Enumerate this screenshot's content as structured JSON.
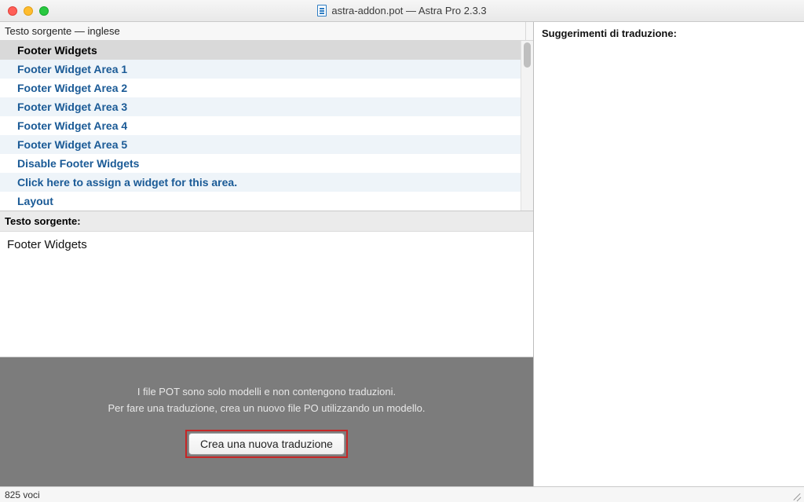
{
  "window": {
    "title": "astra-addon.pot — Astra Pro 2.3.3"
  },
  "left_panel": {
    "list_header": "Testo sorgente — inglese",
    "rows": [
      "Footer Widgets",
      "Footer Widget Area 1",
      "Footer Widget Area 2",
      "Footer Widget Area 3",
      "Footer Widget Area 4",
      "Footer Widget Area 5",
      "Disable Footer Widgets",
      "Click here to assign a widget for this area.",
      "Layout"
    ],
    "selected_index": 0
  },
  "source_section": {
    "label": "Testo sorgente:",
    "text": "Footer Widgets"
  },
  "pot_banner": {
    "line1": "I file POT sono solo modelli e non contengono traduzioni.",
    "line2": "Per fare una traduzione, crea un nuovo file PO utilizzando un modello.",
    "button": "Crea una nuova traduzione"
  },
  "right_panel": {
    "heading": "Suggerimenti di traduzione:"
  },
  "statusbar": {
    "text": "825 voci"
  }
}
